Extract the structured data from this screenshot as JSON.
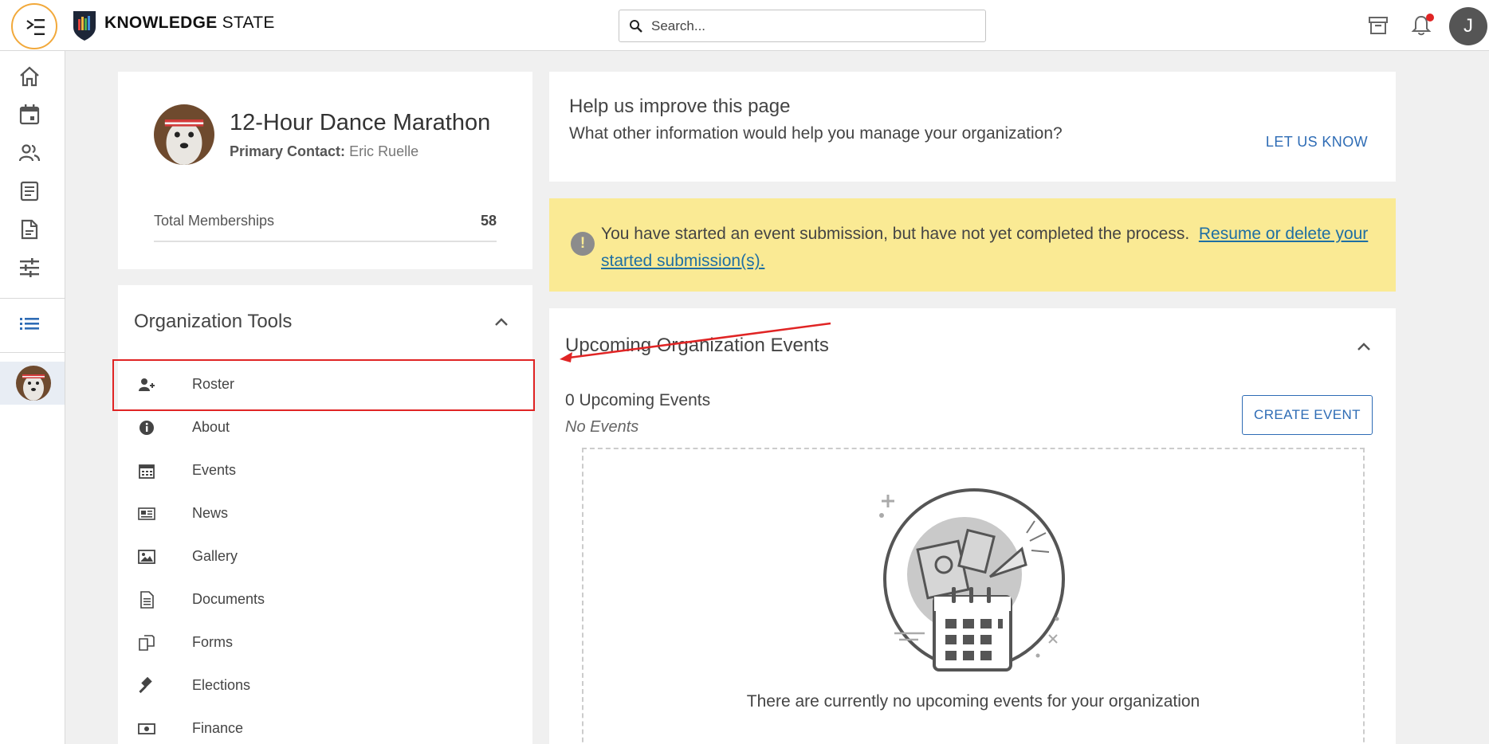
{
  "topbar": {
    "brand_bold": "KNOWLEDGE",
    "brand_light": "STATE",
    "search_placeholder": "Search...",
    "avatar_initial": "J",
    "icons": [
      "menu-icon",
      "shield-logo-icon",
      "search-icon",
      "archive-icon",
      "bell-icon"
    ]
  },
  "rail": {
    "items": [
      "home-icon",
      "calendar-icon",
      "people-icon",
      "article-icon",
      "document-icon",
      "sliders-icon",
      "list-icon"
    ]
  },
  "profile": {
    "name": "12-Hour Dance Marathon",
    "contact_label": "Primary Contact:",
    "contact_name": "Eric Ruelle",
    "memberships_label": "Total Memberships",
    "memberships_count": "58"
  },
  "tools": {
    "title": "Organization Tools",
    "items": [
      {
        "label": "Roster",
        "icon": "user-plus-icon"
      },
      {
        "label": "About",
        "icon": "info-icon"
      },
      {
        "label": "Events",
        "icon": "calendar-icon"
      },
      {
        "label": "News",
        "icon": "newspaper-icon"
      },
      {
        "label": "Gallery",
        "icon": "image-icon"
      },
      {
        "label": "Documents",
        "icon": "document-icon"
      },
      {
        "label": "Forms",
        "icon": "forms-icon"
      },
      {
        "label": "Elections",
        "icon": "gavel-icon"
      },
      {
        "label": "Finance",
        "icon": "money-icon"
      }
    ]
  },
  "help": {
    "title": "Help us improve this page",
    "subtitle": "What other information would help you manage your organization?",
    "link": "LET US KNOW"
  },
  "alert": {
    "text": "You have started an event submission, but have not yet completed the process.",
    "link": "Resume or delete your started submission(s).",
    "icon": "!"
  },
  "events": {
    "title": "Upcoming Organization Events",
    "count_label": "0 Upcoming Events",
    "none_label": "No Events",
    "create_button": "CREATE EVENT",
    "empty_message": "There are currently no upcoming events for your organization"
  },
  "colors": {
    "accent_blue": "#2e6cb5",
    "alert_bg": "#faea94",
    "highlight_red": "#e02424",
    "menu_ring": "#f2a93b"
  }
}
